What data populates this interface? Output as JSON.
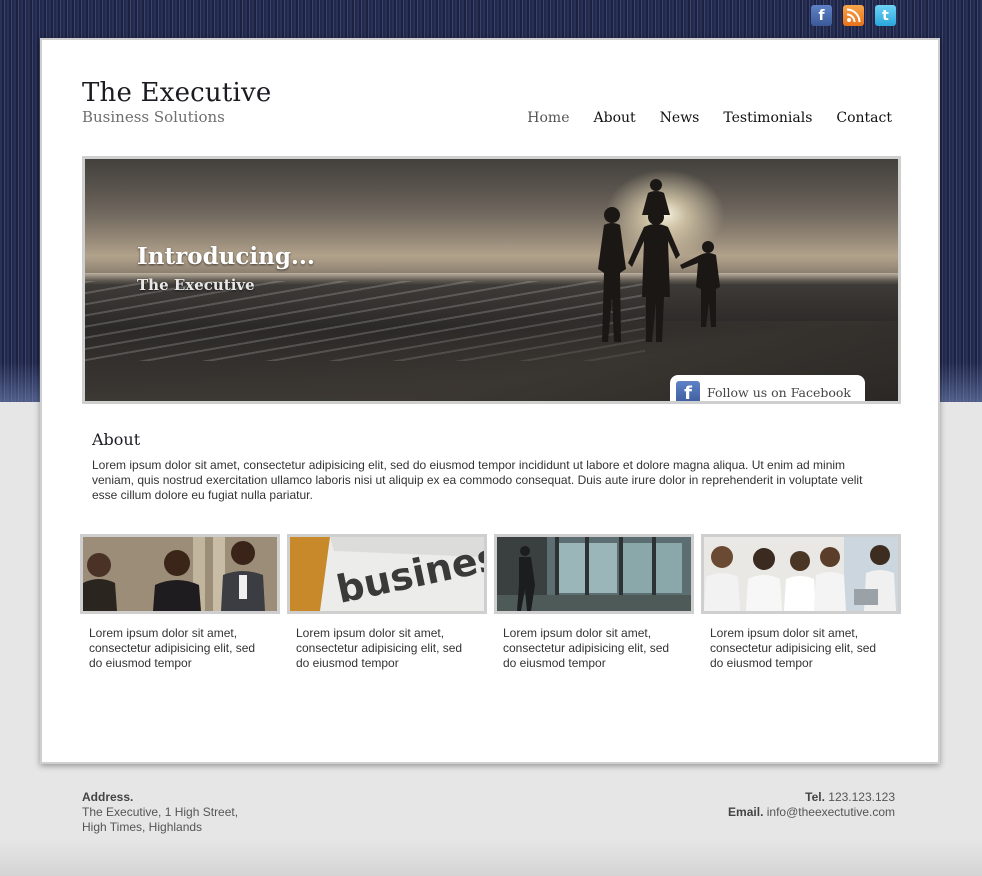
{
  "social": {
    "facebook_icon": "f",
    "rss_icon": "rss",
    "twitter_icon": "t"
  },
  "brand": {
    "title": "The Executive",
    "subtitle": "Business Solutions"
  },
  "nav": {
    "items": [
      {
        "label": "Home",
        "active": true
      },
      {
        "label": "About",
        "active": false
      },
      {
        "label": "News",
        "active": false
      },
      {
        "label": "Testimonials",
        "active": false
      },
      {
        "label": "Contact",
        "active": false
      }
    ]
  },
  "hero": {
    "title": "Introducing...",
    "subtitle": "The Executive",
    "facebook_tab_label": "Follow us on Facebook"
  },
  "about": {
    "heading": "About",
    "text": "Lorem ipsum dolor sit amet, consectetur adipisicing elit, sed do eiusmod tempor incididunt ut labore et dolore magna aliqua. Ut enim ad minim veniam, quis nostrud exercitation ullamco laboris nisi ut aliquip ex ea commodo consequat. Duis aute irure dolor in reprehenderit in voluptate velit esse cillum dolore eu fugiat nulla pariatur."
  },
  "cards": [
    {
      "image": "business-people-photo",
      "text": "Lorem ipsum dolor sit amet, consectetur adipisicing elit, sed do eiusmod tempor"
    },
    {
      "image": "business-newspaper-photo",
      "image_text": "busines",
      "text": "Lorem ipsum dolor sit amet, consectetur adipisicing elit, sed do eiusmod tempor"
    },
    {
      "image": "office-building-photo",
      "text": "Lorem ipsum dolor sit amet, consectetur adipisicing elit, sed do eiusmod tempor"
    },
    {
      "image": "office-team-photo",
      "text": "Lorem ipsum dolor sit amet, consectetur adipisicing elit, sed do eiusmod tempor"
    }
  ],
  "footer": {
    "address_label": "Address.",
    "address_line1": "The Executive, 1 High Street,",
    "address_line2": "High Times, Highlands",
    "tel_label": "Tel.",
    "tel_value": "123.123.123",
    "email_label": "Email.",
    "email_value": "info@theexectutive.com"
  },
  "colors": {
    "header_band": "#23294a",
    "facebook": "#3b5998",
    "rss": "#e8711b",
    "twitter": "#2aa6dc"
  }
}
